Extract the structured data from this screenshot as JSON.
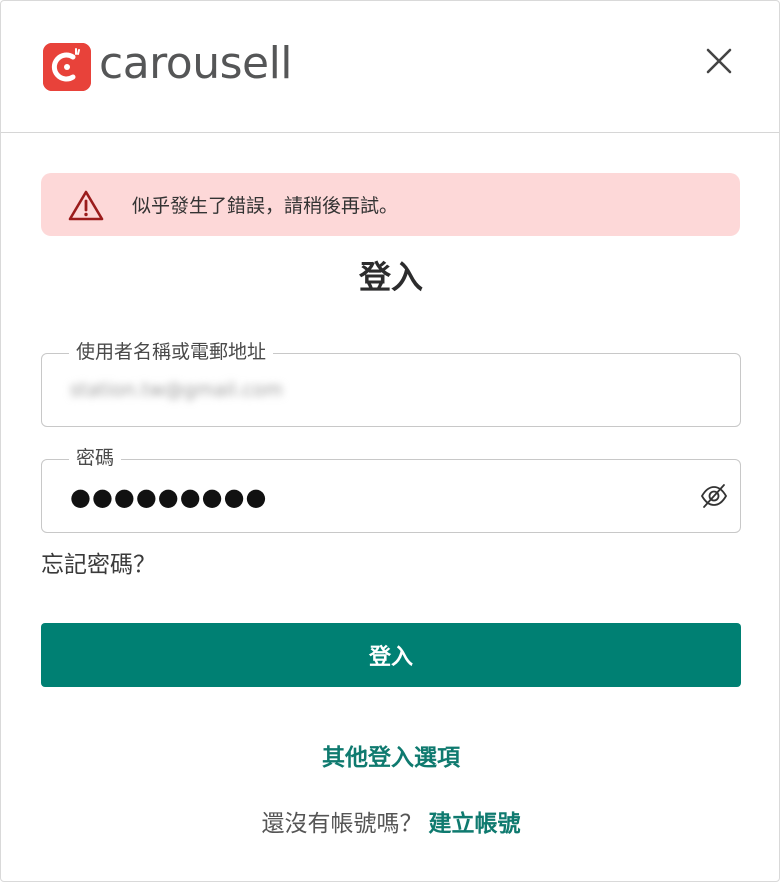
{
  "brand": {
    "name": "carousell",
    "color": "#e8423a"
  },
  "header": {
    "close_icon": "close-icon"
  },
  "alert": {
    "icon": "warning-icon",
    "message": "似乎發生了錯誤，請稍後再試。",
    "background": "#fdd8d8",
    "icon_color": "#9b1c1c"
  },
  "form": {
    "title": "登入",
    "username": {
      "label": "使用者名稱或電郵地址",
      "value": "station.tw@gmail.com"
    },
    "password": {
      "label": "密碼",
      "value": "●●●●●●●●●",
      "toggle_icon": "eye-off-icon"
    },
    "forgot_password": "忘記密碼？",
    "submit_label": "登入",
    "accent": "#008073"
  },
  "footer": {
    "other_options": "其他登入選項",
    "signup_prompt": "還沒有帳號嗎？",
    "signup_link": "建立帳號"
  }
}
